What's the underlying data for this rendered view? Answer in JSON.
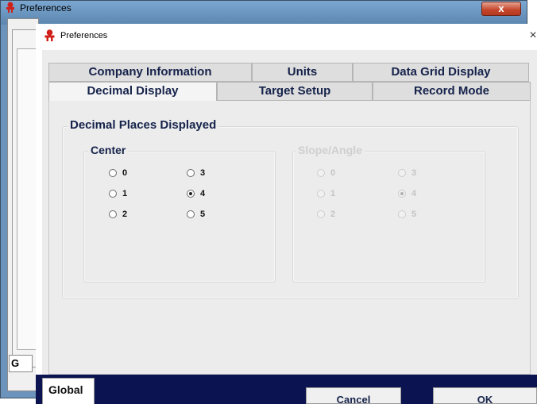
{
  "background_window": {
    "title": "Preferences",
    "close_label": "x",
    "tab_fragment": "G"
  },
  "dialog": {
    "title": "Preferences",
    "close_label": "×"
  },
  "tabs": {
    "row_back": [
      "Company Information",
      "Units",
      "Data Grid Display"
    ],
    "row_front": [
      "Decimal Display",
      "Target Setup",
      "Record Mode"
    ],
    "active": "Decimal Display"
  },
  "decimal_display": {
    "group_title": "Decimal Places Displayed",
    "center": {
      "title": "Center",
      "options": [
        "0",
        "1",
        "2",
        "3",
        "4",
        "5"
      ],
      "selected": "4",
      "enabled": true
    },
    "slope_angle": {
      "title": "Slope/Angle",
      "options": [
        "0",
        "1",
        "2",
        "3",
        "4",
        "5"
      ],
      "selected": "4",
      "enabled": false
    }
  },
  "footer": {
    "global_tab": "Global",
    "cancel_label": "Cancel",
    "ok_label": "OK"
  },
  "colors": {
    "footer_bar": "#0b1350",
    "tab_text": "#15224a",
    "outer_window_frame": "#6c93bb"
  },
  "icons": {
    "app_icon": "red-person-icon"
  }
}
